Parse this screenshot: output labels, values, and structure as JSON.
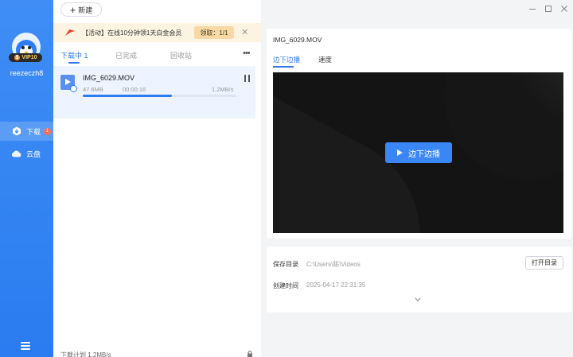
{
  "sidebar": {
    "vip_badge": "VIP10",
    "username": "reezeczh8",
    "items": [
      {
        "label": "下载",
        "badge": "1",
        "icon": "download-icon"
      },
      {
        "label": "云盘",
        "icon": "cloud-icon"
      }
    ]
  },
  "toolbar": {
    "new_label": "新建"
  },
  "promo": {
    "text": "【活动】在线10分钟领1天白金会员",
    "claim_label": "领取：1/1"
  },
  "tabs": [
    {
      "label": "下载中",
      "count": "1"
    },
    {
      "label": "已完成"
    },
    {
      "label": "回收站"
    }
  ],
  "more_label": "•••",
  "download": {
    "filename": "IMG_6029.MOV",
    "size": "47.6MB",
    "elapsed": "00:00:16",
    "speed": "1.2MB/s",
    "progress": 0.58
  },
  "footer": {
    "stat_label": "下载计划   1.2MB/s"
  },
  "preview": {
    "title": "IMG_6029.MOV",
    "tabs": [
      "边下边播",
      "速度"
    ],
    "play_label": "边下边播"
  },
  "info": {
    "dir_label": "保存目录",
    "dir_value": "C:\\Users\\陈\\Videos",
    "open_label": "打开目录",
    "time_label": "创建时间",
    "time_value": "2025-04-17 22:31:35"
  },
  "colors": {
    "accent": "#2f7cf0",
    "sidebar": "#3a87f3",
    "promo_bg": "#fdf3e1"
  }
}
